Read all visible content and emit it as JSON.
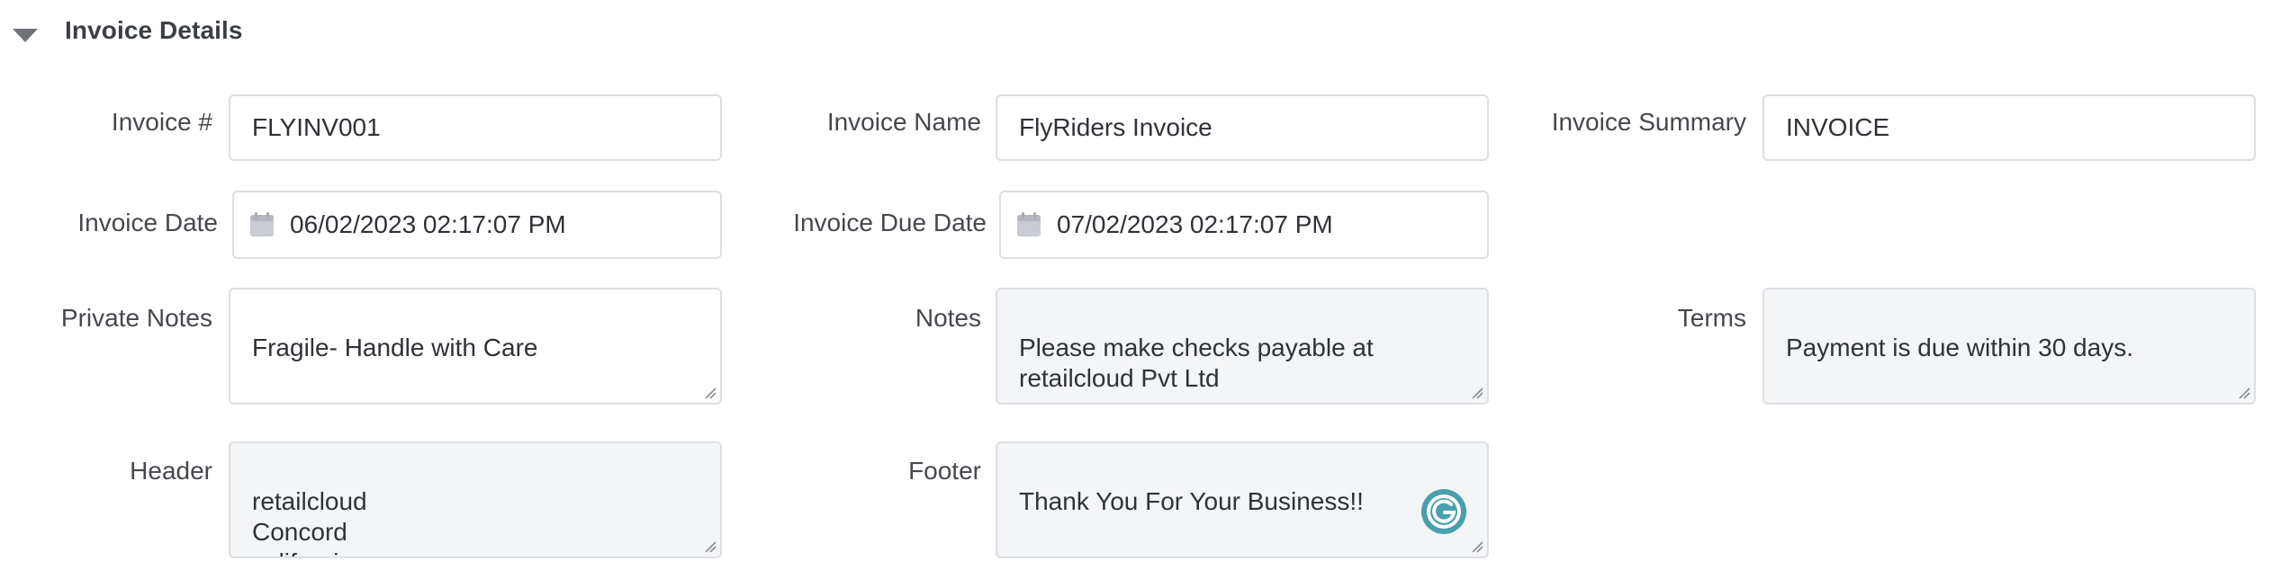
{
  "section": {
    "title": "Invoice Details"
  },
  "fields": {
    "invoice_number": {
      "label": "Invoice #",
      "value": "FLYINV001"
    },
    "invoice_name": {
      "label": "Invoice Name",
      "value": "FlyRiders Invoice"
    },
    "invoice_summary": {
      "label": "Invoice Summary",
      "value": "INVOICE"
    },
    "invoice_date": {
      "label": "Invoice Date",
      "value": "06/02/2023 02:17:07 PM"
    },
    "invoice_due_date": {
      "label": "Invoice Due Date",
      "value": "07/02/2023 02:17:07 PM"
    },
    "private_notes": {
      "label": "Private Notes",
      "value": "Fragile- Handle with Care"
    },
    "notes": {
      "label": "Notes",
      "value": "Please make checks payable at\nretailcloud Pvt Ltd"
    },
    "terms": {
      "label": "Terms",
      "value": "Payment is due within 30 days."
    },
    "header": {
      "label": "Header",
      "value": "retailcloud\nConcord\ncalifornia"
    },
    "footer": {
      "label": "Footer",
      "value": "Thank You For Your Business!!"
    }
  },
  "icons": {
    "collapse": "caret-down-icon",
    "calendar": "calendar-icon",
    "grammarly": "grammarly-icon"
  },
  "colors": {
    "border": "#dcdfe3",
    "readonly_bg": "#f4f5f7",
    "grammarly": "#4a9fae"
  }
}
